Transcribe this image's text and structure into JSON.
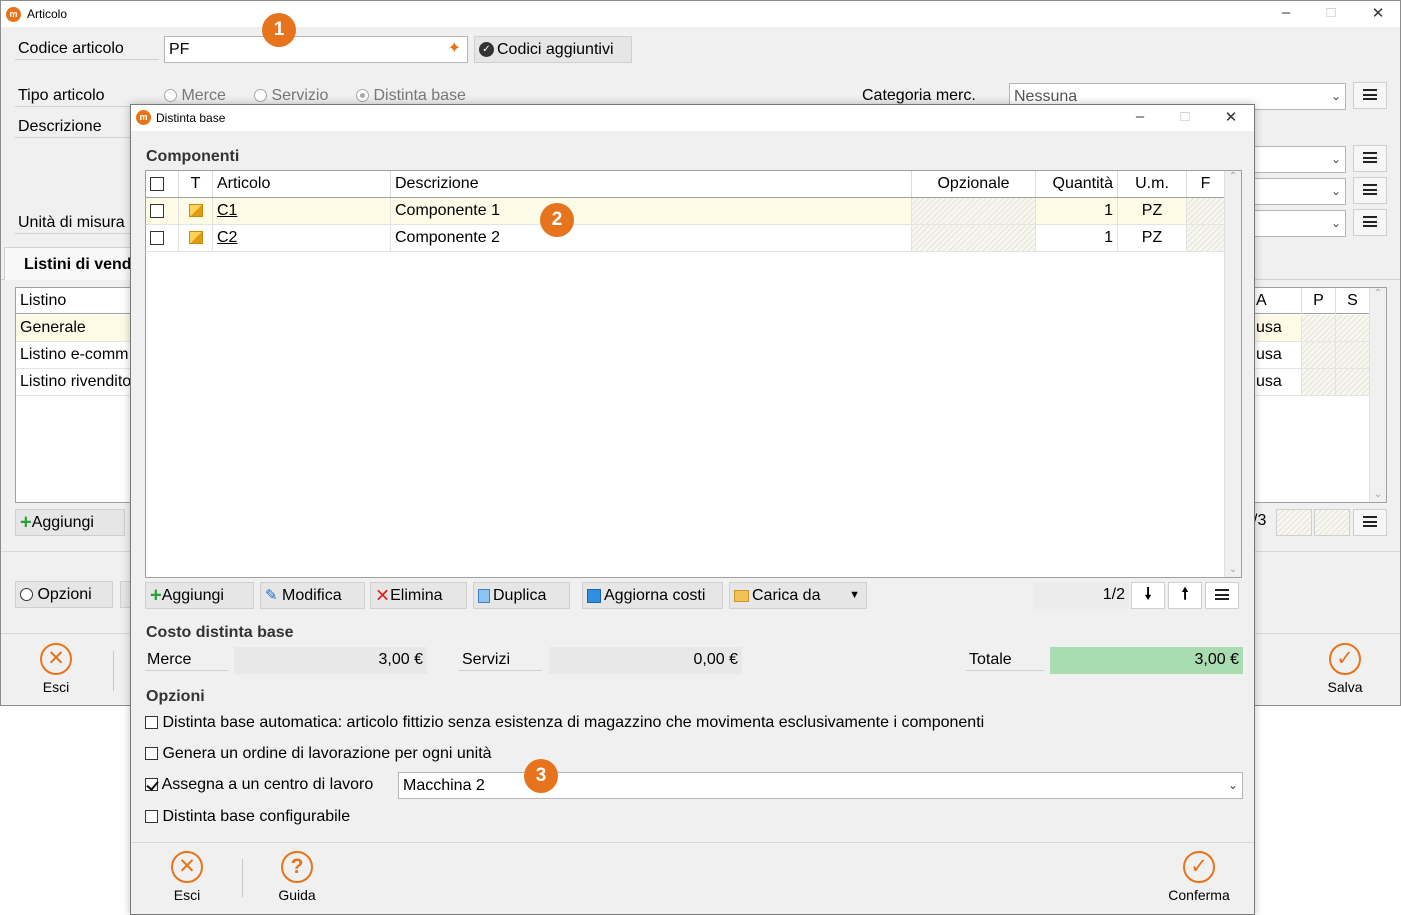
{
  "main_window": {
    "title": "Articolo",
    "code_label": "Codice articolo",
    "code_value": "PF",
    "extra_codes_button": "Codici aggiuntivi",
    "type_label": "Tipo articolo",
    "type_options": [
      "Merce",
      "Servizio",
      "Distinta base"
    ],
    "type_selected": "Distinta base",
    "category_label": "Categoria merc.",
    "category_value": "Nessuna",
    "description_label": "Descrizione",
    "unit_label": "Unità di misura",
    "tab_label": "Listini di vend",
    "price_grid": {
      "headers": [
        "Listino",
        "A",
        "P",
        "S"
      ],
      "rows": [
        {
          "listino": "Generale",
          "a": "usa"
        },
        {
          "listino": "Listino e-comm",
          "a": "usa"
        },
        {
          "listino": "Listino rivendito",
          "a": "usa"
        }
      ],
      "pager": "/3"
    },
    "add_button": "Aggiungi",
    "options_button": "Opzioni",
    "exit_label": "Esci",
    "save_label": "Salva"
  },
  "dialog": {
    "title": "Distinta base",
    "components_heading": "Componenti",
    "grid_headers": {
      "t": "T",
      "articolo": "Articolo",
      "descrizione": "Descrizione",
      "opzionale": "Opzionale",
      "quantita": "Quantità",
      "um": "U.m.",
      "f": "F"
    },
    "rows": [
      {
        "articolo": "C1",
        "descrizione": "Componente 1",
        "quantita": "1",
        "um": "PZ"
      },
      {
        "articolo": "C2",
        "descrizione": "Componente 2",
        "quantita": "1",
        "um": "PZ"
      }
    ],
    "toolbar": {
      "add": "Aggiungi",
      "edit": "Modifica",
      "delete": "Elimina",
      "duplicate": "Duplica",
      "update_costs": "Aggiorna costi",
      "load_from": "Carica da"
    },
    "pager": "1/2",
    "cost_heading": "Costo distinta base",
    "merce_label": "Merce",
    "merce_value": "3,00 €",
    "servizi_label": "Servizi",
    "servizi_value": "0,00 €",
    "totale_label": "Totale",
    "totale_value": "3,00 €",
    "options_heading": "Opzioni",
    "options": [
      {
        "label": "Distinta base automatica: articolo fittizio senza esistenza di magazzino che movimenta esclusivamente i componenti",
        "checked": false
      },
      {
        "label": "Genera un ordine di lavorazione per ogni unità",
        "checked": false
      },
      {
        "label": "Assegna a un centro di lavoro",
        "checked": true
      },
      {
        "label": "Distinta base configurabile",
        "checked": false
      }
    ],
    "work_center_value": "Macchina 2",
    "exit_label": "Esci",
    "help_label": "Guida",
    "confirm_label": "Conferma"
  },
  "badges": [
    "1",
    "2",
    "3"
  ],
  "colors": {
    "accent": "#e8731a",
    "total_bg": "#a9dcb1",
    "selected_row": "#fdfbe6"
  }
}
